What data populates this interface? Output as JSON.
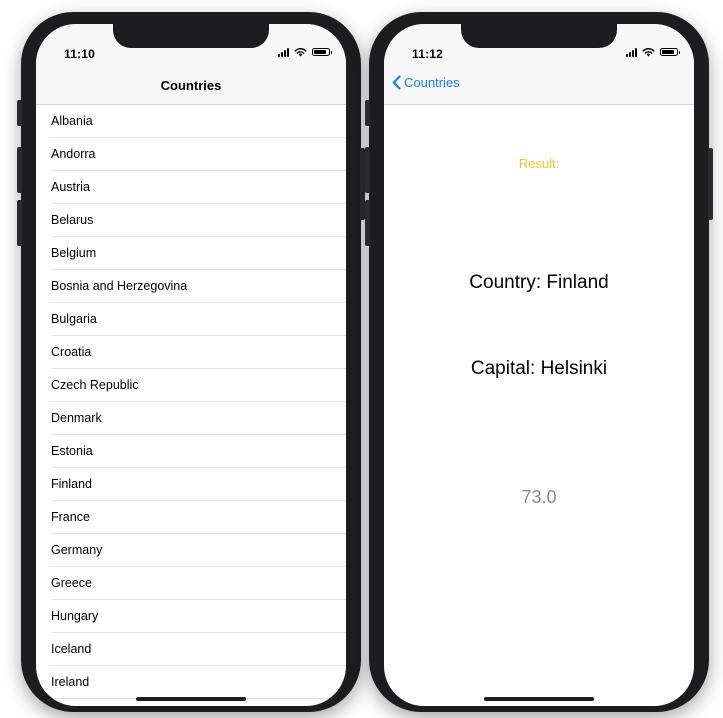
{
  "left_screen": {
    "status_time": "11:10",
    "nav_title": "Countries",
    "countries": [
      "Albania",
      "Andorra",
      "Austria",
      "Belarus",
      "Belgium",
      "Bosnia and Herzegovina",
      "Bulgaria",
      "Croatia",
      "Czech Republic",
      "Denmark",
      "Estonia",
      "Finland",
      "France",
      "Germany",
      "Greece",
      "Hungary",
      "Iceland",
      "Ireland"
    ]
  },
  "right_screen": {
    "status_time": "11:12",
    "back_label": "Countries",
    "result_label": "Result:",
    "country_text": "Country: Finland",
    "capital_text": "Capital: Helsinki",
    "value_text": "73.0"
  },
  "colors": {
    "accent_blue": "#1a7ef2",
    "result_yellow": "#f5c42b",
    "value_gray": "#8a8a8a"
  }
}
